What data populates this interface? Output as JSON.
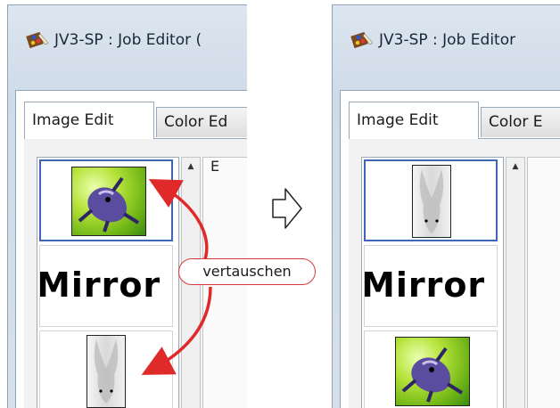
{
  "left_window": {
    "title": "JV3-SP : Job Editor (",
    "tabs": [
      "Image Edit",
      "Color Ed"
    ],
    "side_label": "E",
    "items": [
      {
        "kind": "frog",
        "selected": true
      },
      {
        "kind": "mirror",
        "text": "Mirror",
        "selected": false
      },
      {
        "kind": "rabbit",
        "selected": false
      }
    ]
  },
  "right_window": {
    "title": "JV3-SP : Job Editor",
    "tabs": [
      "Image Edit",
      "Color E"
    ],
    "items": [
      {
        "kind": "rabbit",
        "selected": true
      },
      {
        "kind": "mirror",
        "text": "Mirror",
        "selected": false
      },
      {
        "kind": "frog",
        "selected": false
      }
    ]
  },
  "annotation": {
    "swap_label": "vertauschen",
    "color": "#e02a2a"
  },
  "icons": {
    "app": "palette-icon",
    "transition": "right-arrow-icon",
    "scroll_up": "scroll-up-arrow-icon"
  }
}
